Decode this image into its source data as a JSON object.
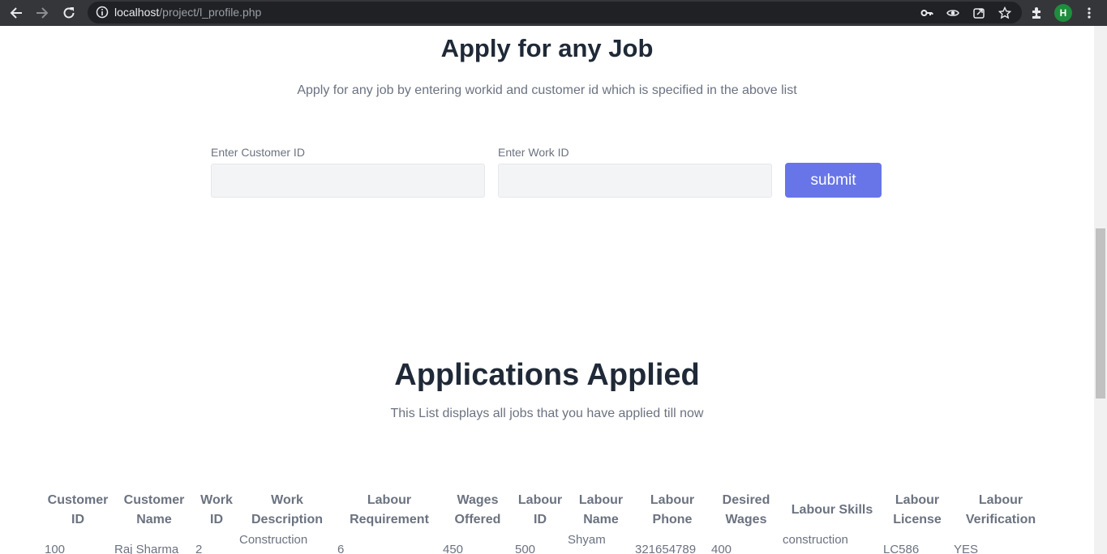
{
  "browser": {
    "url_host": "localhost",
    "url_path": "/project/l_profile.php",
    "profile_initial": "H"
  },
  "apply": {
    "title": "Apply for any Job",
    "subtitle": "Apply for any job by entering workid and customer id which is specified in the above list",
    "customer_label": "Enter Customer ID",
    "customer_value": "",
    "work_label": "Enter Work ID",
    "work_value": "",
    "submit_label": "submit"
  },
  "applications": {
    "title": "Applications Applied",
    "subtitle": "This List displays all jobs that you have applied till now",
    "headers": [
      [
        "Customer",
        "ID"
      ],
      [
        "Customer",
        "Name"
      ],
      [
        "Work",
        "ID"
      ],
      [
        "Work",
        "Description"
      ],
      [
        "Labour",
        "Requirement"
      ],
      [
        "Wages",
        "Offered"
      ],
      [
        "Labour",
        "ID"
      ],
      [
        "Labour",
        "Name"
      ],
      [
        "Labour",
        "Phone"
      ],
      [
        "Desired",
        "Wages"
      ],
      [
        "Labour Skills"
      ],
      [
        "Labour",
        "License"
      ],
      [
        "Labour",
        "Verification"
      ]
    ],
    "rows": [
      {
        "customer_id": "100",
        "customer_name": "Raj Sharma",
        "work_id": "2",
        "work_description": "Construction",
        "labour_requirement": "6",
        "wages_offered": "450",
        "labour_id": "500",
        "labour_name": "Shyam",
        "labour_phone": "321654789",
        "desired_wages": "400",
        "labour_skills": "construction",
        "labour_license": "LC586",
        "labour_verification": "YES"
      }
    ]
  }
}
